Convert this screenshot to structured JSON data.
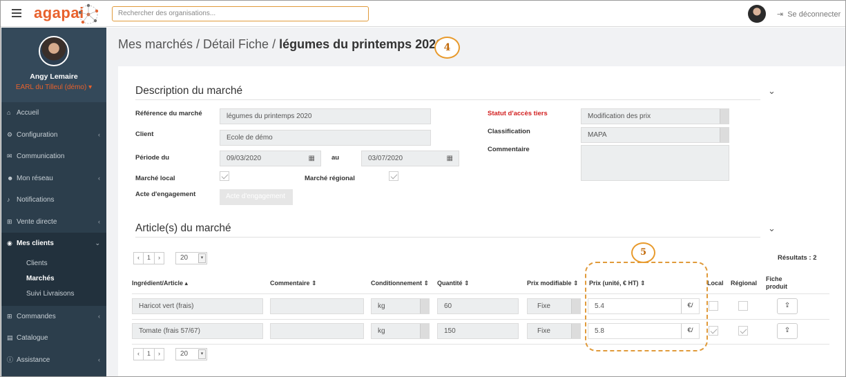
{
  "app": {
    "logo": "agapai"
  },
  "search": {
    "placeholder": "Rechercher des organisations..."
  },
  "topbar": {
    "logout_label": "Se déconnecter"
  },
  "profile": {
    "name": "Angy Lemaire",
    "farm": "EARL du Tilleul (démo) ▾"
  },
  "sidebar": {
    "items": [
      {
        "label": "Accueil",
        "icon": "home-icon",
        "glyph": "⌂",
        "chevron": ""
      },
      {
        "label": "Configuration",
        "icon": "cogs-icon",
        "glyph": "⚙",
        "chevron": "‹"
      },
      {
        "label": "Communication",
        "icon": "comments-icon",
        "glyph": "✉",
        "chevron": ""
      },
      {
        "label": "Mon réseau",
        "icon": "users-icon",
        "glyph": "☻",
        "chevron": "‹"
      },
      {
        "label": "Notifications",
        "icon": "bell-icon",
        "glyph": "♪",
        "chevron": ""
      },
      {
        "label": "Vente directe",
        "icon": "cart-icon",
        "glyph": "⊞",
        "chevron": "‹"
      },
      {
        "label": "Mes clients",
        "icon": "eye-icon",
        "glyph": "◉",
        "chevron": "⌄"
      },
      {
        "label": "Commandes",
        "icon": "cart-icon",
        "glyph": "⊞",
        "chevron": "‹"
      },
      {
        "label": "Catalogue",
        "icon": "book-icon",
        "glyph": "▤",
        "chevron": ""
      },
      {
        "label": "Assistance",
        "icon": "info-icon",
        "glyph": "ⓘ",
        "chevron": "‹"
      }
    ],
    "submenu": [
      "Clients",
      "Marchés",
      "Suivi Livraisons"
    ]
  },
  "breadcrumb": {
    "part1": "Mes marchés / Détail Fiche / ",
    "current": "légumes du printemps 2020"
  },
  "annotations": {
    "a4": "4",
    "a5": "5"
  },
  "description": {
    "title": "Description du marché",
    "ref_label": "Référence du marché",
    "ref_value": "légumes du printemps 2020",
    "client_label": "Client",
    "client_value": "Ecole de démo",
    "period_label": "Période du",
    "period_from": "09/03/2020",
    "au_label": "au",
    "period_to": "03/07/2020",
    "local_label": "Marché local",
    "regional_label": "Marché régional",
    "acte_label": "Acte d'engagement",
    "acte_button": "Acte d'engagement",
    "statut_label": "Statut d'accès tiers",
    "statut_value": "Modification des prix",
    "class_label": "Classification",
    "class_value": "MAPA",
    "comment_label": "Commentaire"
  },
  "articles": {
    "title": "Article(s) du marché",
    "page": "1",
    "prev": "‹",
    "next": "›",
    "page_size": "20",
    "results": "Résultats : 2",
    "headers": {
      "article": "Ingrédient/Article ▴",
      "comment": "Commentaire ⇕",
      "cond": "Conditionnement ⇕",
      "qty": "Quantité ⇕",
      "mod": "Prix modifiable ⇕",
      "price": "Prix (unité, € HT) ⇕",
      "local": "Local",
      "regional": "Régional",
      "fiche1": "Fiche",
      "fiche2": "produit"
    },
    "rows": [
      {
        "article": "Haricot vert (frais)",
        "comment": "",
        "cond": "kg",
        "qty": "60",
        "mod": "Fixe",
        "price": "5.4",
        "unit": "€/",
        "local": false,
        "regional": false
      },
      {
        "article": "Tomate (frais  57/67)",
        "comment": "",
        "cond": "kg",
        "qty": "150",
        "mod": "Fixe",
        "price": "5.8",
        "unit": "€/",
        "local": true,
        "regional": true
      }
    ]
  },
  "colors": {
    "accent": "#e8612c",
    "sidebar": "#2c3e4c",
    "highlight": "#e09a3a"
  }
}
